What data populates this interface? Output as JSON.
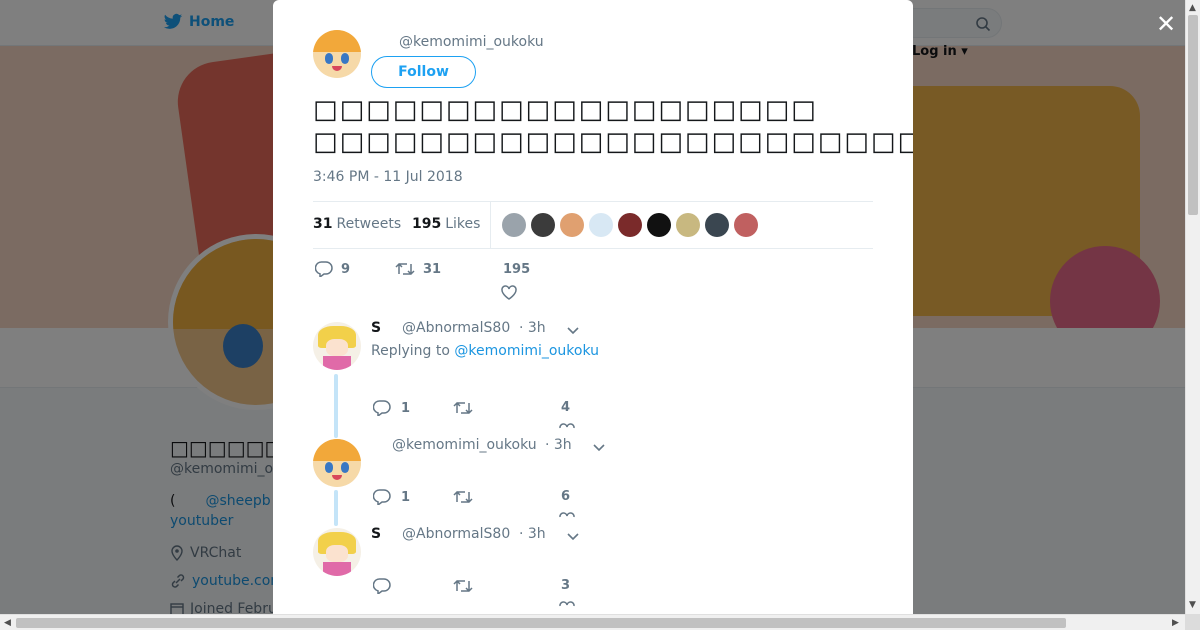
{
  "background": {
    "nav_home": "Home",
    "login": "Log in",
    "profile_name": "□□□□□□□□□",
    "profile_handle": "@kemomimi_o",
    "bio_line1_prefix": "(",
    "bio_line1_link": "@sheepb",
    "bio_line2": "youtuber",
    "location": "VRChat",
    "website": "youtube.com",
    "joined": "Joined Febru"
  },
  "tweet": {
    "handle": "@kemomimi_oukoku",
    "follow_label": "Follow",
    "text_line1": "□□□□□□□□□□□□□□□□□□□",
    "text_line2": "□□□□□□□□□□□□□□□□□□□□□□□□□□□□□□□□□□□□□□□□□□□□□□□□□□□□□□□□□□□□",
    "timestamp": "3:46 PM - 11 Jul 2018",
    "retweets_count": "31",
    "retweets_label": "Retweets",
    "likes_count": "195",
    "likes_label": "Likes",
    "reply_count": "9",
    "retweet_count": "31",
    "like_count": "195",
    "liker_colors": [
      "#9aa3ab",
      "#3b3b3b",
      "#e0a070",
      "#d8e8f4",
      "#7a2a2a",
      "#111111",
      "#c8b880",
      "#3a4650",
      "#c06060"
    ]
  },
  "replies": [
    {
      "name": "S",
      "handle": "@AbnormalS80",
      "time": "· 3h",
      "replying_label": "Replying to",
      "replying_to": "@kemomimi_oukoku",
      "reply_count": "1",
      "like_count": "4"
    },
    {
      "name": "",
      "handle": "@kemomimi_oukoku",
      "time": "· 3h",
      "reply_count": "1",
      "like_count": "6"
    },
    {
      "name": "S",
      "handle": "@AbnormalS80",
      "time": "· 3h",
      "reply_count": "",
      "like_count": "3"
    }
  ],
  "colors": {
    "accent": "#1da1f2",
    "link": "#1b95e0",
    "muted": "#657786"
  }
}
